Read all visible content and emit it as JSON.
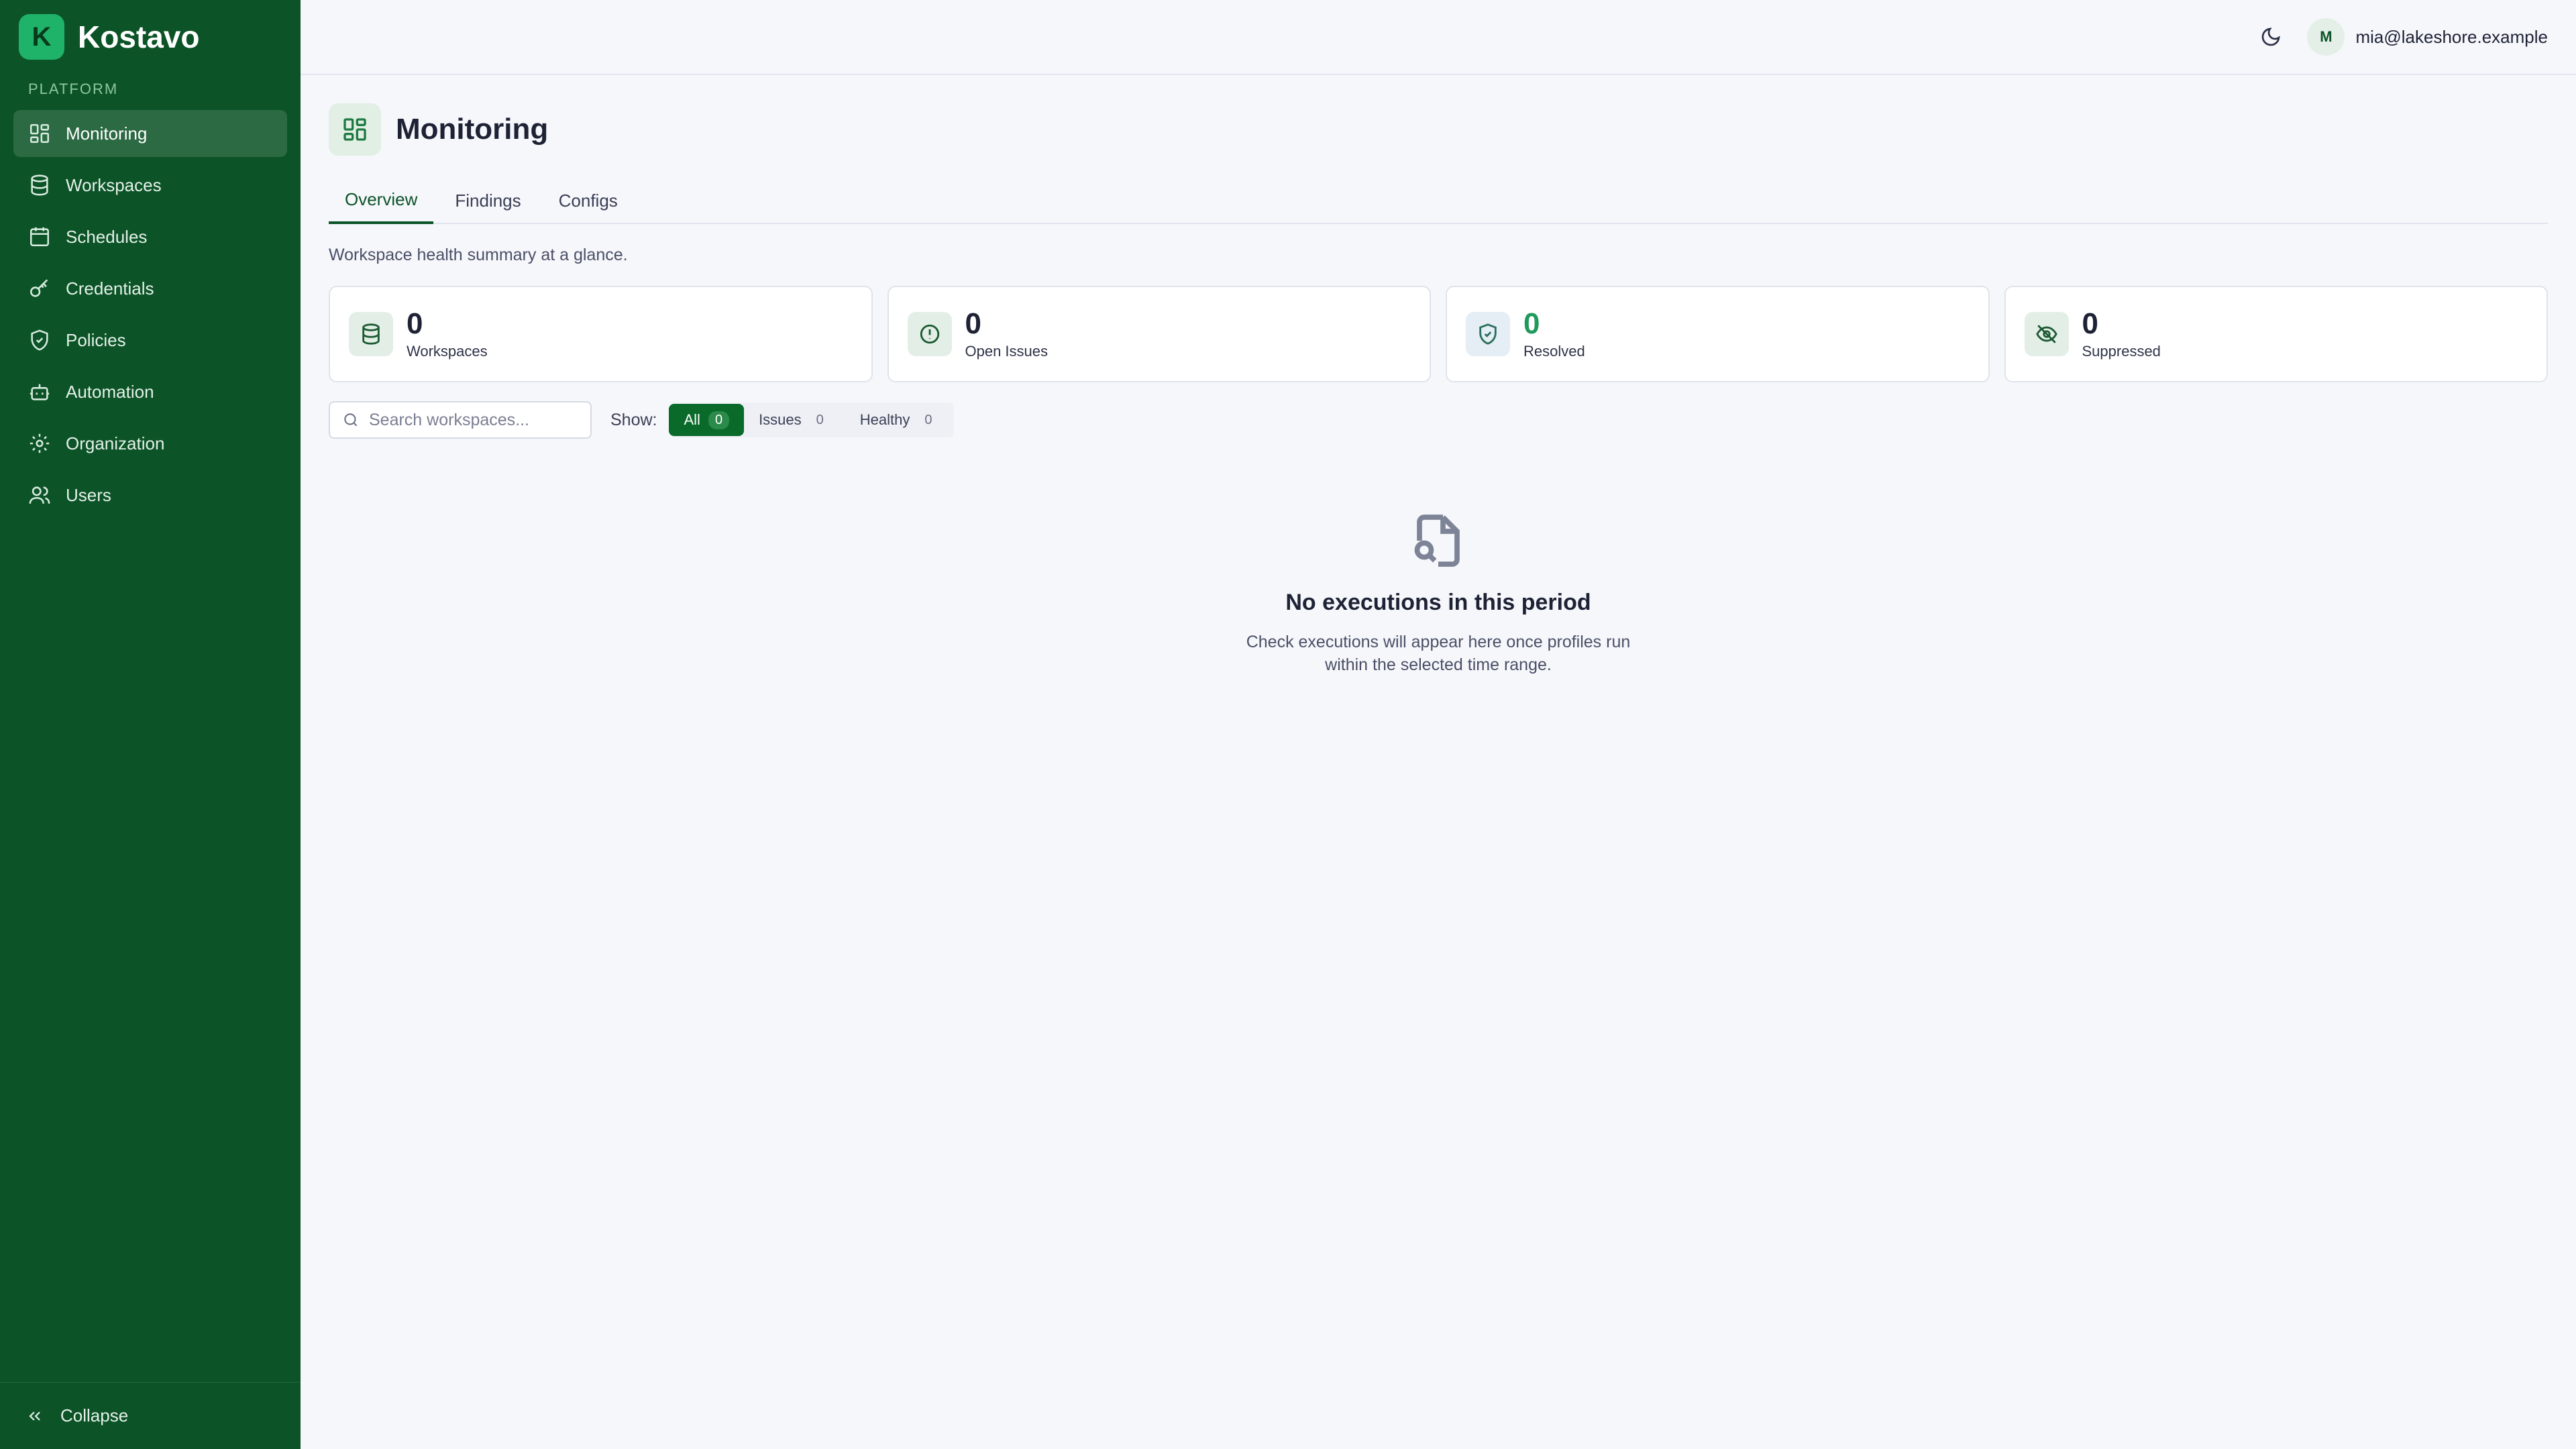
{
  "app": {
    "name": "Kostavo",
    "logo_letter": "K"
  },
  "sidebar": {
    "section": "PLATFORM",
    "items": [
      {
        "label": "Monitoring",
        "icon": "dashboard-icon"
      },
      {
        "label": "Workspaces",
        "icon": "database-icon"
      },
      {
        "label": "Schedules",
        "icon": "calendar-icon"
      },
      {
        "label": "Credentials",
        "icon": "key-icon"
      },
      {
        "label": "Policies",
        "icon": "shield-icon"
      },
      {
        "label": "Automation",
        "icon": "robot-icon"
      },
      {
        "label": "Organization",
        "icon": "gear-icon"
      },
      {
        "label": "Users",
        "icon": "users-icon"
      }
    ],
    "collapse_label": "Collapse"
  },
  "topbar": {
    "avatar_initial": "M",
    "user_email": "mia@lakeshore.example"
  },
  "page": {
    "title": "Monitoring",
    "tabs": [
      {
        "label": "Overview"
      },
      {
        "label": "Findings"
      },
      {
        "label": "Configs"
      }
    ],
    "summary": "Workspace health summary at a glance."
  },
  "stats": [
    {
      "value": "0",
      "label": "Workspaces",
      "icon": "database-icon"
    },
    {
      "value": "0",
      "label": "Open Issues",
      "icon": "alert-circle-icon"
    },
    {
      "value": "0",
      "label": "Resolved",
      "icon": "shield-check-icon"
    },
    {
      "value": "0",
      "label": "Suppressed",
      "icon": "eye-off-icon"
    }
  ],
  "filters": {
    "search_placeholder": "Search workspaces...",
    "show_label": "Show:",
    "options": [
      {
        "label": "All",
        "count": "0"
      },
      {
        "label": "Issues",
        "count": "0"
      },
      {
        "label": "Healthy",
        "count": "0"
      }
    ]
  },
  "empty": {
    "title": "No executions in this period",
    "description": "Check executions will appear here once profiles run within the selected time range."
  },
  "colors": {
    "sidebar": "#0c5327",
    "accent": "#0a6a2a",
    "resolved": "#1f9a5c"
  }
}
